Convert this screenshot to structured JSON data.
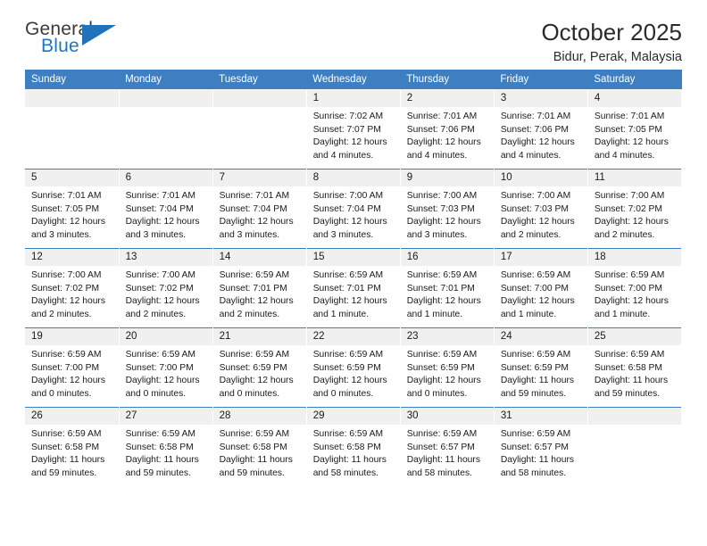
{
  "logo": {
    "word_top": "General",
    "word_bottom": "Blue",
    "triangle_icon": "blue-triangle-icon",
    "accent_color": "#1f72bb"
  },
  "header": {
    "title": "October 2025",
    "subtitle": "Bidur, Perak, Malaysia"
  },
  "theme": {
    "header_row_bg": "#3d7fc1",
    "daynum_bg": "#f0f0f0",
    "row_divider": "#3d7fc1",
    "text": "#1a1a1a"
  },
  "weekday_headers": [
    "Sunday",
    "Monday",
    "Tuesday",
    "Wednesday",
    "Thursday",
    "Friday",
    "Saturday"
  ],
  "weeks": [
    [
      {
        "day": "",
        "empty": true,
        "sunrise": "",
        "sunset": "",
        "daylight_line1": "",
        "daylight_line2": ""
      },
      {
        "day": "",
        "empty": true,
        "sunrise": "",
        "sunset": "",
        "daylight_line1": "",
        "daylight_line2": ""
      },
      {
        "day": "",
        "empty": true,
        "sunrise": "",
        "sunset": "",
        "daylight_line1": "",
        "daylight_line2": ""
      },
      {
        "day": "1",
        "empty": false,
        "sunrise": "Sunrise: 7:02 AM",
        "sunset": "Sunset: 7:07 PM",
        "daylight_line1": "Daylight: 12 hours",
        "daylight_line2": "and 4 minutes."
      },
      {
        "day": "2",
        "empty": false,
        "sunrise": "Sunrise: 7:01 AM",
        "sunset": "Sunset: 7:06 PM",
        "daylight_line1": "Daylight: 12 hours",
        "daylight_line2": "and 4 minutes."
      },
      {
        "day": "3",
        "empty": false,
        "sunrise": "Sunrise: 7:01 AM",
        "sunset": "Sunset: 7:06 PM",
        "daylight_line1": "Daylight: 12 hours",
        "daylight_line2": "and 4 minutes."
      },
      {
        "day": "4",
        "empty": false,
        "sunrise": "Sunrise: 7:01 AM",
        "sunset": "Sunset: 7:05 PM",
        "daylight_line1": "Daylight: 12 hours",
        "daylight_line2": "and 4 minutes."
      }
    ],
    [
      {
        "day": "5",
        "empty": false,
        "sunrise": "Sunrise: 7:01 AM",
        "sunset": "Sunset: 7:05 PM",
        "daylight_line1": "Daylight: 12 hours",
        "daylight_line2": "and 3 minutes."
      },
      {
        "day": "6",
        "empty": false,
        "sunrise": "Sunrise: 7:01 AM",
        "sunset": "Sunset: 7:04 PM",
        "daylight_line1": "Daylight: 12 hours",
        "daylight_line2": "and 3 minutes."
      },
      {
        "day": "7",
        "empty": false,
        "sunrise": "Sunrise: 7:01 AM",
        "sunset": "Sunset: 7:04 PM",
        "daylight_line1": "Daylight: 12 hours",
        "daylight_line2": "and 3 minutes."
      },
      {
        "day": "8",
        "empty": false,
        "sunrise": "Sunrise: 7:00 AM",
        "sunset": "Sunset: 7:04 PM",
        "daylight_line1": "Daylight: 12 hours",
        "daylight_line2": "and 3 minutes."
      },
      {
        "day": "9",
        "empty": false,
        "sunrise": "Sunrise: 7:00 AM",
        "sunset": "Sunset: 7:03 PM",
        "daylight_line1": "Daylight: 12 hours",
        "daylight_line2": "and 3 minutes."
      },
      {
        "day": "10",
        "empty": false,
        "sunrise": "Sunrise: 7:00 AM",
        "sunset": "Sunset: 7:03 PM",
        "daylight_line1": "Daylight: 12 hours",
        "daylight_line2": "and 2 minutes."
      },
      {
        "day": "11",
        "empty": false,
        "sunrise": "Sunrise: 7:00 AM",
        "sunset": "Sunset: 7:02 PM",
        "daylight_line1": "Daylight: 12 hours",
        "daylight_line2": "and 2 minutes."
      }
    ],
    [
      {
        "day": "12",
        "empty": false,
        "sunrise": "Sunrise: 7:00 AM",
        "sunset": "Sunset: 7:02 PM",
        "daylight_line1": "Daylight: 12 hours",
        "daylight_line2": "and 2 minutes."
      },
      {
        "day": "13",
        "empty": false,
        "sunrise": "Sunrise: 7:00 AM",
        "sunset": "Sunset: 7:02 PM",
        "daylight_line1": "Daylight: 12 hours",
        "daylight_line2": "and 2 minutes."
      },
      {
        "day": "14",
        "empty": false,
        "sunrise": "Sunrise: 6:59 AM",
        "sunset": "Sunset: 7:01 PM",
        "daylight_line1": "Daylight: 12 hours",
        "daylight_line2": "and 2 minutes."
      },
      {
        "day": "15",
        "empty": false,
        "sunrise": "Sunrise: 6:59 AM",
        "sunset": "Sunset: 7:01 PM",
        "daylight_line1": "Daylight: 12 hours",
        "daylight_line2": "and 1 minute."
      },
      {
        "day": "16",
        "empty": false,
        "sunrise": "Sunrise: 6:59 AM",
        "sunset": "Sunset: 7:01 PM",
        "daylight_line1": "Daylight: 12 hours",
        "daylight_line2": "and 1 minute."
      },
      {
        "day": "17",
        "empty": false,
        "sunrise": "Sunrise: 6:59 AM",
        "sunset": "Sunset: 7:00 PM",
        "daylight_line1": "Daylight: 12 hours",
        "daylight_line2": "and 1 minute."
      },
      {
        "day": "18",
        "empty": false,
        "sunrise": "Sunrise: 6:59 AM",
        "sunset": "Sunset: 7:00 PM",
        "daylight_line1": "Daylight: 12 hours",
        "daylight_line2": "and 1 minute."
      }
    ],
    [
      {
        "day": "19",
        "empty": false,
        "sunrise": "Sunrise: 6:59 AM",
        "sunset": "Sunset: 7:00 PM",
        "daylight_line1": "Daylight: 12 hours",
        "daylight_line2": "and 0 minutes."
      },
      {
        "day": "20",
        "empty": false,
        "sunrise": "Sunrise: 6:59 AM",
        "sunset": "Sunset: 7:00 PM",
        "daylight_line1": "Daylight: 12 hours",
        "daylight_line2": "and 0 minutes."
      },
      {
        "day": "21",
        "empty": false,
        "sunrise": "Sunrise: 6:59 AM",
        "sunset": "Sunset: 6:59 PM",
        "daylight_line1": "Daylight: 12 hours",
        "daylight_line2": "and 0 minutes."
      },
      {
        "day": "22",
        "empty": false,
        "sunrise": "Sunrise: 6:59 AM",
        "sunset": "Sunset: 6:59 PM",
        "daylight_line1": "Daylight: 12 hours",
        "daylight_line2": "and 0 minutes."
      },
      {
        "day": "23",
        "empty": false,
        "sunrise": "Sunrise: 6:59 AM",
        "sunset": "Sunset: 6:59 PM",
        "daylight_line1": "Daylight: 12 hours",
        "daylight_line2": "and 0 minutes."
      },
      {
        "day": "24",
        "empty": false,
        "sunrise": "Sunrise: 6:59 AM",
        "sunset": "Sunset: 6:59 PM",
        "daylight_line1": "Daylight: 11 hours",
        "daylight_line2": "and 59 minutes."
      },
      {
        "day": "25",
        "empty": false,
        "sunrise": "Sunrise: 6:59 AM",
        "sunset": "Sunset: 6:58 PM",
        "daylight_line1": "Daylight: 11 hours",
        "daylight_line2": "and 59 minutes."
      }
    ],
    [
      {
        "day": "26",
        "empty": false,
        "sunrise": "Sunrise: 6:59 AM",
        "sunset": "Sunset: 6:58 PM",
        "daylight_line1": "Daylight: 11 hours",
        "daylight_line2": "and 59 minutes."
      },
      {
        "day": "27",
        "empty": false,
        "sunrise": "Sunrise: 6:59 AM",
        "sunset": "Sunset: 6:58 PM",
        "daylight_line1": "Daylight: 11 hours",
        "daylight_line2": "and 59 minutes."
      },
      {
        "day": "28",
        "empty": false,
        "sunrise": "Sunrise: 6:59 AM",
        "sunset": "Sunset: 6:58 PM",
        "daylight_line1": "Daylight: 11 hours",
        "daylight_line2": "and 59 minutes."
      },
      {
        "day": "29",
        "empty": false,
        "sunrise": "Sunrise: 6:59 AM",
        "sunset": "Sunset: 6:58 PM",
        "daylight_line1": "Daylight: 11 hours",
        "daylight_line2": "and 58 minutes."
      },
      {
        "day": "30",
        "empty": false,
        "sunrise": "Sunrise: 6:59 AM",
        "sunset": "Sunset: 6:57 PM",
        "daylight_line1": "Daylight: 11 hours",
        "daylight_line2": "and 58 minutes."
      },
      {
        "day": "31",
        "empty": false,
        "sunrise": "Sunrise: 6:59 AM",
        "sunset": "Sunset: 6:57 PM",
        "daylight_line1": "Daylight: 11 hours",
        "daylight_line2": "and 58 minutes."
      },
      {
        "day": "",
        "empty": true,
        "sunrise": "",
        "sunset": "",
        "daylight_line1": "",
        "daylight_line2": ""
      }
    ]
  ]
}
